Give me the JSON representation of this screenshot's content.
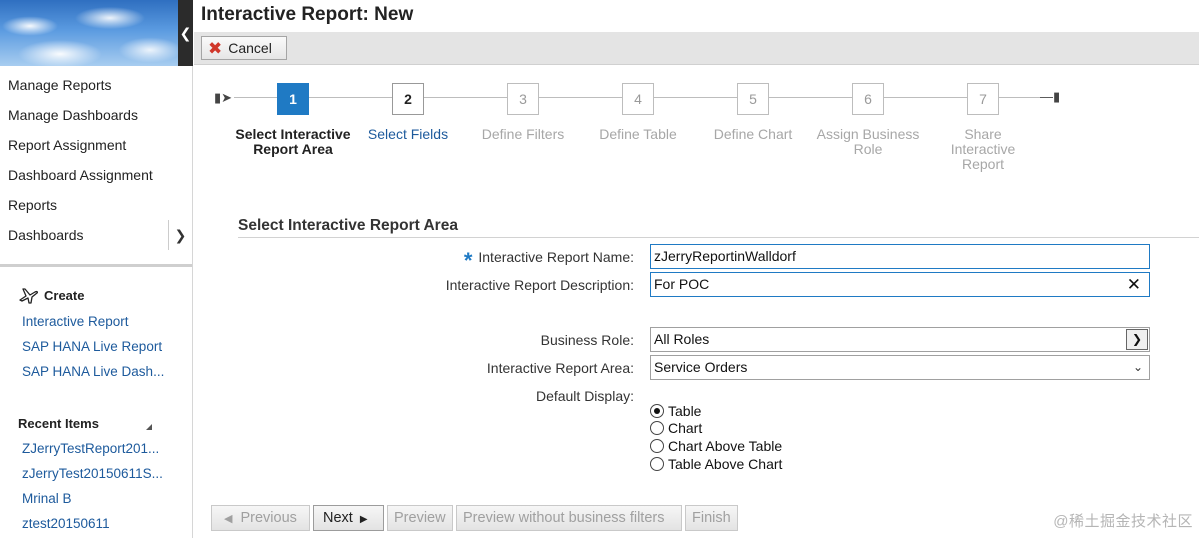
{
  "sidebar": {
    "collapse_icon": "chevron-left-icon",
    "nav_items": [
      {
        "label": "Manage Reports"
      },
      {
        "label": "Manage Dashboards"
      },
      {
        "label": "Report Assignment"
      },
      {
        "label": "Dashboard Assignment"
      },
      {
        "label": "Reports"
      },
      {
        "label": "Dashboards",
        "has_arrow": true
      }
    ],
    "create": {
      "title": "Create",
      "icon": "airplane-icon",
      "links": [
        "Interactive Report",
        "SAP HANA Live Report",
        "SAP HANA Live Dash..."
      ]
    },
    "recent": {
      "title": "Recent Items",
      "links": [
        "ZJerryTestReport201...",
        "zJerryTest20150611S...",
        "Mrinal B",
        "ztest20150611"
      ]
    }
  },
  "header": {
    "title": "Interactive Report: New",
    "cancel_label": "Cancel"
  },
  "wizard": {
    "steps": [
      {
        "number": "1",
        "label": "Select Interactive Report Area",
        "state": "active"
      },
      {
        "number": "2",
        "label": "Select Fields",
        "state": "next"
      },
      {
        "number": "3",
        "label": "Define Filters",
        "state": "disabled"
      },
      {
        "number": "4",
        "label": "Define Table",
        "state": "disabled"
      },
      {
        "number": "5",
        "label": "Define Chart",
        "state": "disabled"
      },
      {
        "number": "6",
        "label": "Assign Business Role",
        "state": "disabled"
      },
      {
        "number": "7",
        "label": "Share Interactive Report",
        "state": "disabled"
      }
    ]
  },
  "form": {
    "section_title": "Select Interactive Report Area",
    "name_label": "Interactive Report Name:",
    "name_value": "zJerryReportinWalldorf",
    "description_label": "Interactive Report Description:",
    "description_value": "For POC",
    "business_role_label": "Business Role:",
    "business_role_value": "All Roles",
    "area_label": "Interactive Report Area:",
    "area_value": "Service Orders",
    "default_display_label": "Default Display:",
    "display_options": [
      "Table",
      "Chart",
      "Chart Above Table",
      "Table Above Chart"
    ],
    "display_selected": "Table"
  },
  "footer": {
    "previous_label": "Previous",
    "next_label": "Next",
    "preview_label": "Preview",
    "preview_without_label": "Preview without business filters",
    "finish_label": "Finish",
    "watermark": "@稀土掘金技术社区"
  }
}
